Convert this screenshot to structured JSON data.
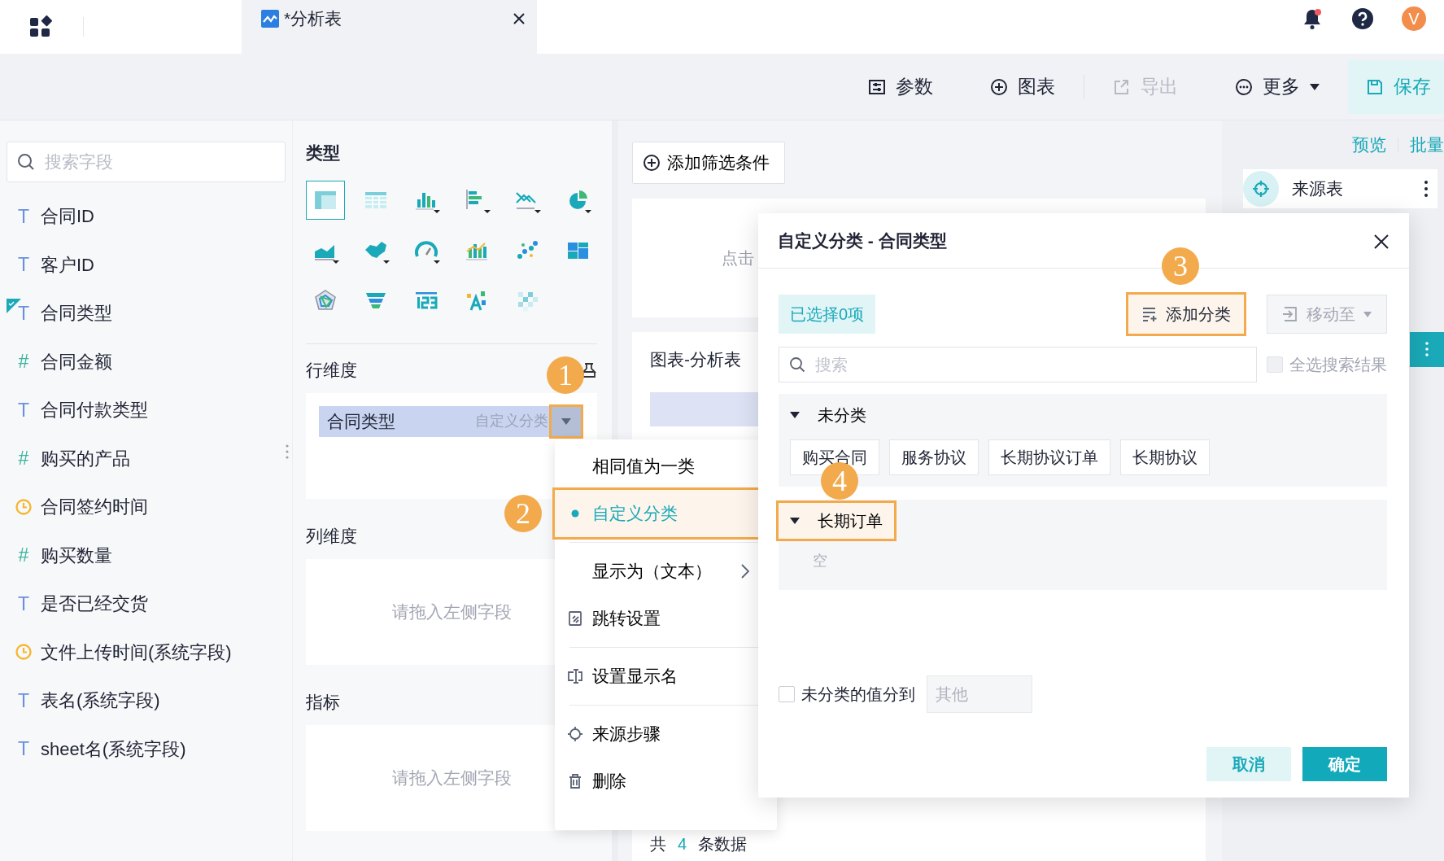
{
  "tabs": [
    {
      "label": "*分析表",
      "selected": true
    }
  ],
  "header": {
    "unread": true,
    "avatar": "V"
  },
  "toolbar": [
    {
      "kind": "params",
      "label": "参数",
      "disabled": false
    },
    {
      "kind": "chart",
      "label": "图表",
      "disabled": false
    },
    {
      "kind": "export",
      "label": "导出",
      "disabled": true
    },
    {
      "kind": "more",
      "label": "更多",
      "disabled": false
    },
    {
      "kind": "save",
      "label": "保存",
      "disabled": false
    }
  ],
  "fields": {
    "placeholder": "搜索字段",
    "items": [
      {
        "kind": "text",
        "icon": "T",
        "label": "合同ID",
        "used": false
      },
      {
        "kind": "text",
        "icon": "T",
        "label": "客户ID",
        "used": false
      },
      {
        "kind": "text",
        "icon": "T",
        "label": "合同类型",
        "used": true
      },
      {
        "kind": "number",
        "icon": "#",
        "label": "合同金额",
        "used": false
      },
      {
        "kind": "text",
        "icon": "T",
        "label": "合同付款类型",
        "used": false
      },
      {
        "kind": "number",
        "icon": "#",
        "label": "购买的产品",
        "used": false
      },
      {
        "kind": "date",
        "label": "合同签约时间",
        "used": false
      },
      {
        "kind": "number",
        "icon": "#",
        "label": "购买数量",
        "used": false
      },
      {
        "kind": "text",
        "icon": "T",
        "label": "是否已经交货",
        "used": false
      },
      {
        "kind": "date",
        "label": "文件上传时间(系统字段)",
        "used": false
      },
      {
        "kind": "text",
        "icon": "T",
        "label": "表名(系统字段)",
        "used": false
      },
      {
        "kind": "text",
        "icon": "T",
        "label": "sheet名(系统字段)",
        "used": false
      }
    ]
  },
  "chart_types": {
    "title": "类型",
    "items": [
      {
        "kind": "table",
        "selected": true
      },
      {
        "kind": "detail",
        "selected": false
      },
      {
        "kind": "column",
        "selected": false
      },
      {
        "kind": "bar",
        "selected": false
      },
      {
        "kind": "line",
        "selected": false
      },
      {
        "kind": "pie",
        "selected": false
      },
      {
        "kind": "area",
        "selected": false
      },
      {
        "kind": "map",
        "selected": false
      },
      {
        "kind": "gauge",
        "selected": false
      },
      {
        "kind": "combo",
        "selected": false
      },
      {
        "kind": "scatter",
        "selected": false
      },
      {
        "kind": "treemap",
        "selected": false
      },
      {
        "kind": "radar",
        "selected": false
      },
      {
        "kind": "funnel",
        "selected": false
      },
      {
        "kind": "number",
        "selected": false
      },
      {
        "kind": "wordcloud",
        "selected": false
      },
      {
        "kind": "heatmap",
        "selected": false
      }
    ]
  },
  "row_dimension": {
    "title": "行维度",
    "chip": {
      "label": "合同类型",
      "note": "自定义分类",
      "highlighted": true,
      "badge": "1"
    }
  },
  "column_dimension": {
    "title": "列维度",
    "placeholder": "请拖入左侧字段"
  },
  "metrics": {
    "title": "指标",
    "placeholder": "请拖入左侧字段"
  },
  "filter_button": "添加筛选条件",
  "filter_card": {
    "hint": "点击"
  },
  "chart_card": {
    "title": "图表-分析表",
    "count_prefix": "共",
    "count": "4",
    "count_suffix": "条数据"
  },
  "right_panel": {
    "links": [
      "预览",
      "批量"
    ],
    "steps": [
      {
        "label": "来源表"
      }
    ]
  },
  "context_menu": {
    "items": [
      {
        "kind": "plain",
        "label": "相同值为一类",
        "selected": false,
        "separated": false
      },
      {
        "kind": "plain",
        "label": "自定义分类",
        "selected": true,
        "separated": false,
        "highlighted": true,
        "badge": "2"
      },
      {
        "kind": "submenu",
        "label": "显示为（文本）",
        "selected": false,
        "separated": true
      },
      {
        "kind": "jump",
        "label": "跳转设置",
        "selected": false,
        "separated": false
      },
      {
        "kind": "rename",
        "label": "设置显示名",
        "selected": false,
        "separated": true
      },
      {
        "kind": "source",
        "label": "来源步骤",
        "selected": false,
        "separated": true
      },
      {
        "kind": "delete",
        "label": "删除",
        "selected": false,
        "separated": false
      }
    ]
  },
  "dialog": {
    "title": "自定义分类 - 合同类型",
    "selected_count": "已选择0项",
    "add_button": {
      "label": "添加分类",
      "highlighted": true,
      "badge": "3"
    },
    "move_button": {
      "label": "移动至",
      "disabled": true
    },
    "search": {
      "placeholder": "搜索"
    },
    "select_all": {
      "label": "全选搜索结果",
      "checked": false,
      "disabled": true
    },
    "groups": [
      {
        "name": "未分类",
        "expanded": true,
        "highlighted": false,
        "values": [
          "购买合同",
          "服务协议",
          "长期协议订单",
          "长期协议"
        ]
      },
      {
        "name": "长期订单",
        "expanded": true,
        "highlighted": true,
        "badge": "4",
        "empty_text": "空"
      }
    ],
    "other": {
      "label": "未分类的值分到",
      "checked": false,
      "placeholder": "其他"
    },
    "buttons": [
      {
        "kind": "cancel",
        "label": "取消"
      },
      {
        "kind": "ok",
        "label": "确定"
      }
    ]
  }
}
